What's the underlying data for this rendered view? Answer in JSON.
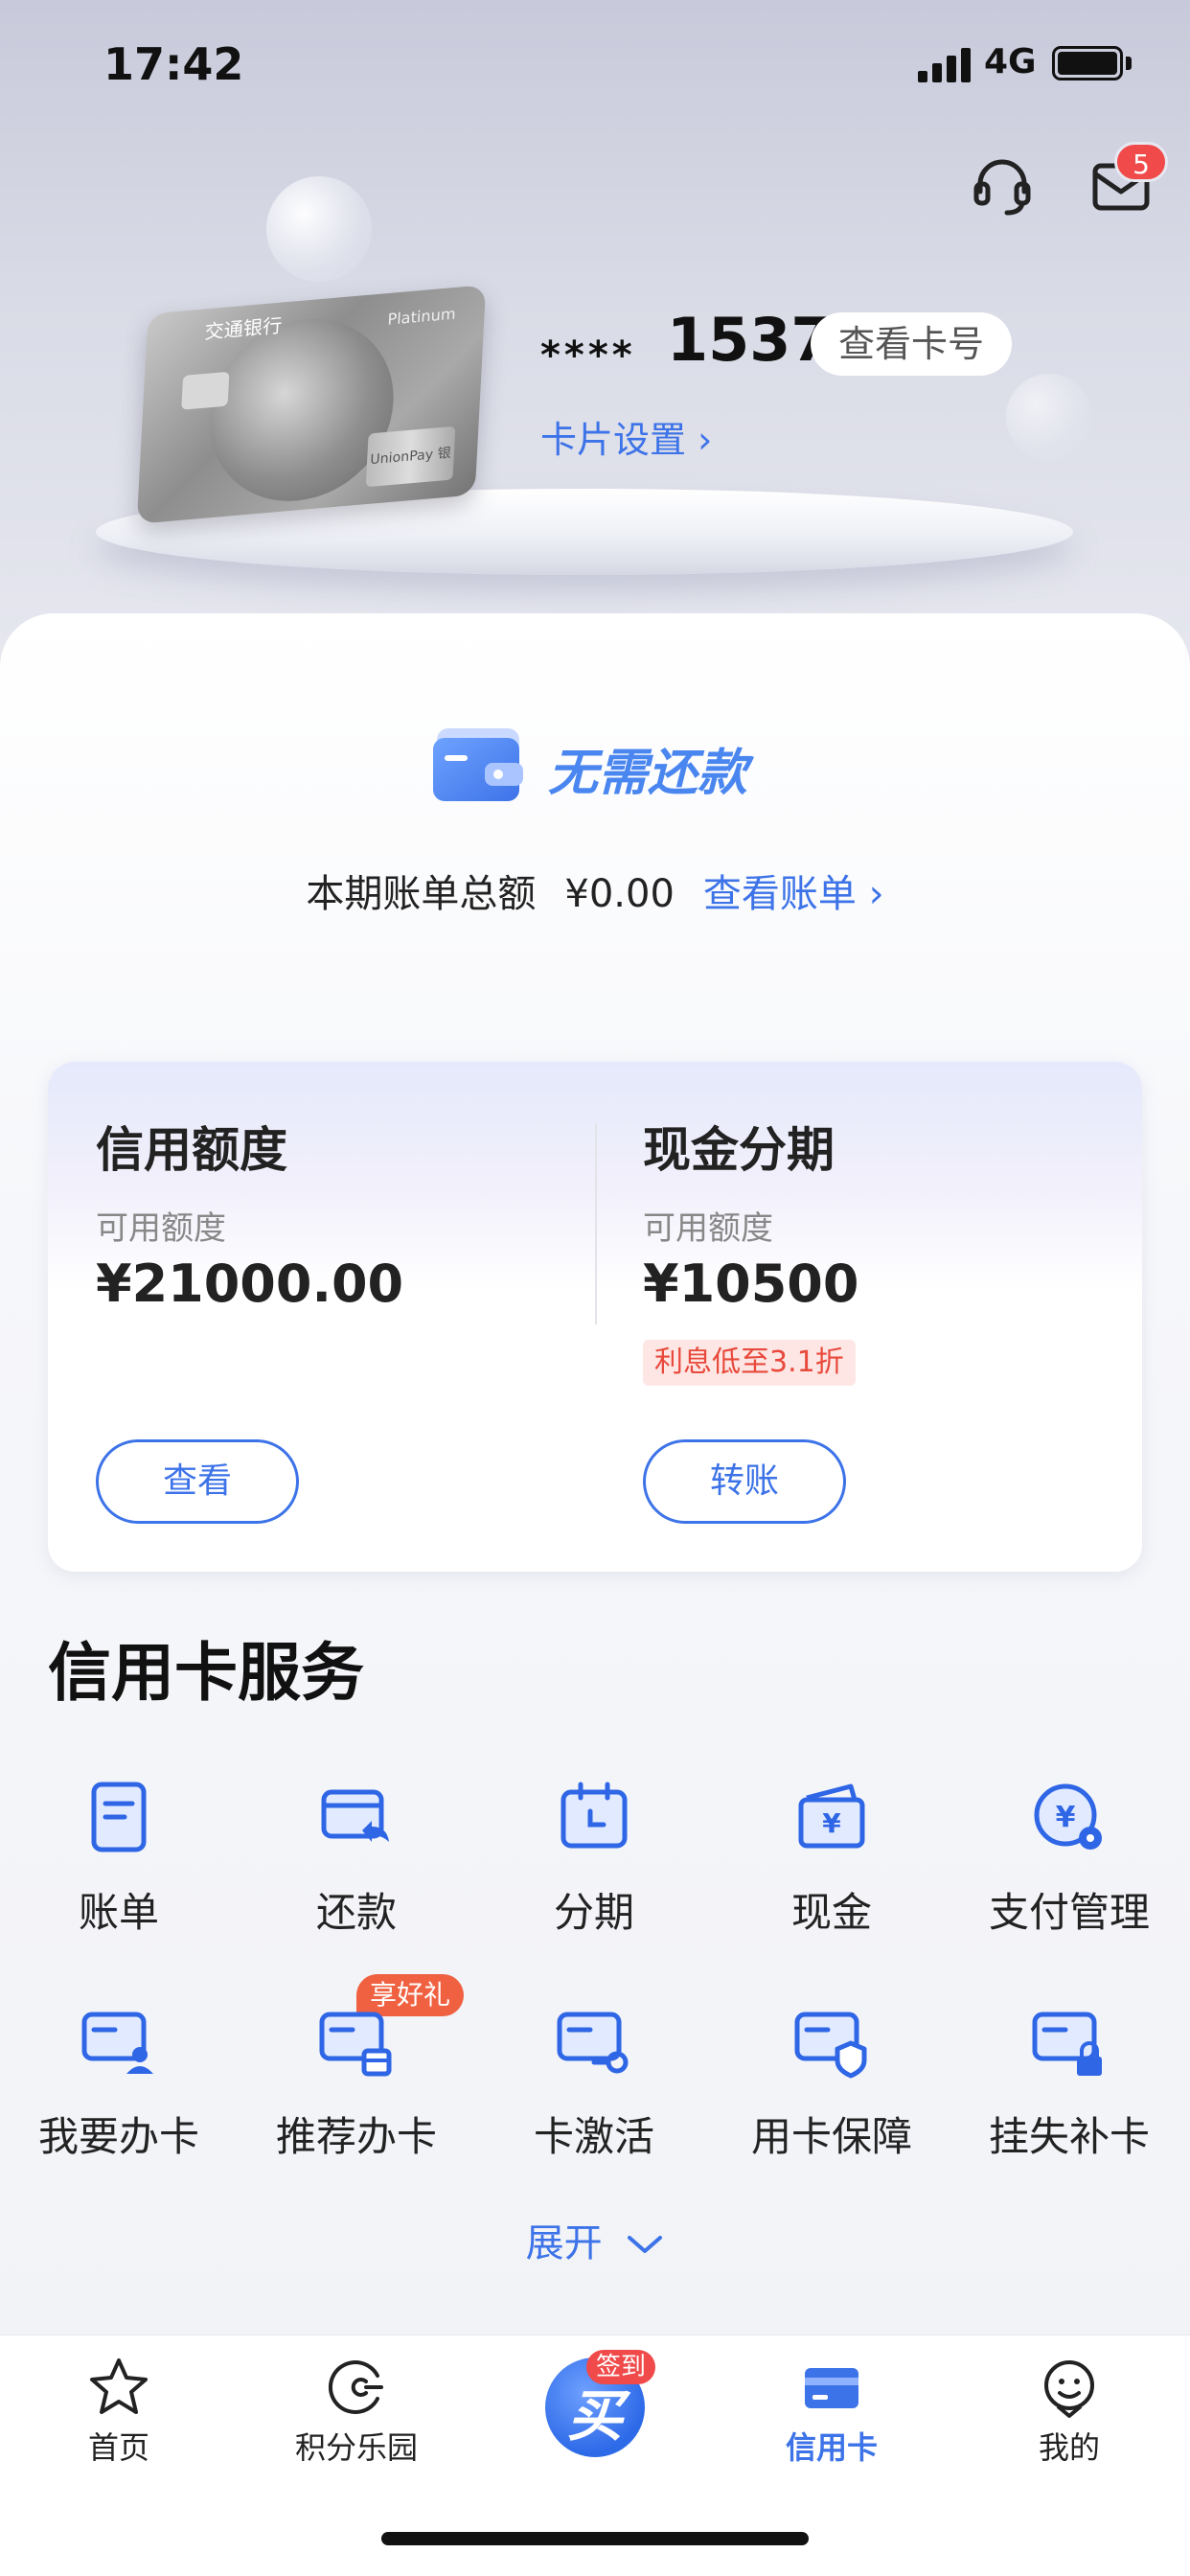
{
  "status_bar": {
    "time": "17:42",
    "network": "4G"
  },
  "header": {
    "mail_badge_count": "5"
  },
  "card": {
    "bank_name": "交通银行",
    "card_brand": "Platinum",
    "network_logo": "UnionPay 银联",
    "masked_prefix": "****",
    "last_four": "1537",
    "view_number_label": "查看卡号",
    "settings_label": "卡片设置 ›"
  },
  "repayment_status": {
    "title": "无需还款",
    "bill_total_label": "本期账单总额",
    "bill_total_value": "¥0.00",
    "view_bill_label": "查看账单 ›"
  },
  "credit_panel": {
    "left": {
      "title": "信用额度",
      "sub_label": "可用额度",
      "amount": "¥21000.00",
      "button": "查看"
    },
    "right": {
      "title": "现金分期",
      "sub_label": "可用额度",
      "amount": "¥10500",
      "tag": "利息低至3.1折",
      "button": "转账"
    }
  },
  "services": {
    "title": "信用卡服务",
    "items": [
      {
        "label": "账单",
        "icon": "bill-icon"
      },
      {
        "label": "还款",
        "icon": "repay-icon"
      },
      {
        "label": "分期",
        "icon": "installment-icon"
      },
      {
        "label": "现金",
        "icon": "cash-icon"
      },
      {
        "label": "支付管理",
        "icon": "payment-settings-icon"
      },
      {
        "label": "我要办卡",
        "icon": "apply-card-icon"
      },
      {
        "label": "推荐办卡",
        "icon": "recommend-card-icon"
      },
      {
        "label": "卡激活",
        "icon": "activate-card-icon"
      },
      {
        "label": "用卡保障",
        "icon": "card-protection-icon"
      },
      {
        "label": "挂失补卡",
        "icon": "report-loss-icon"
      }
    ],
    "gift_badge": "享好礼",
    "expand_label": "展开"
  },
  "tab_bar": {
    "tabs": [
      {
        "label": "首页",
        "icon": "star-icon"
      },
      {
        "label": "积分乐园",
        "icon": "points-icon"
      },
      {
        "label": "信用卡",
        "icon": "credit-card-icon"
      },
      {
        "label": "我的",
        "icon": "profile-icon"
      }
    ],
    "center_glyph": "买",
    "center_badge": "签到",
    "active_tab": "信用卡"
  },
  "colors": {
    "accent": "#3d73e8",
    "badge_red": "#f04a4a",
    "tag_red": "#e8493c"
  }
}
